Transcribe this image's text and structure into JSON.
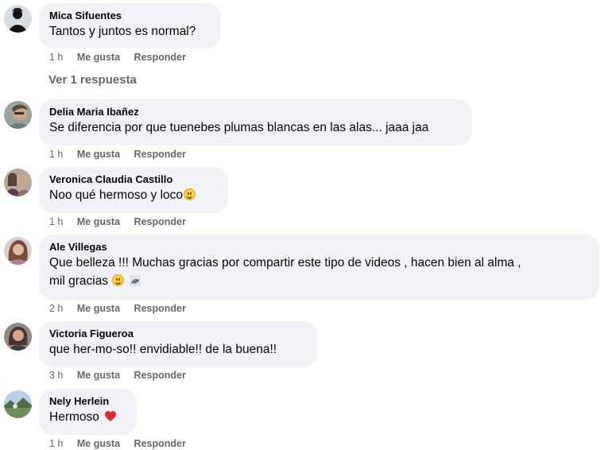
{
  "comments": [
    {
      "author": "Mica Sifuentes",
      "text": "Tantos y juntos es normal?",
      "time": "1 h",
      "like_label": "Me gusta",
      "reply_label": "Responder",
      "avatar_icon": "avatar-silhouette-icon"
    },
    {
      "author": "Delia Maria Ibañez",
      "text": "Se diferencia por que tuenebes plumas blancas en las alas... jaaa jaa",
      "time": "1 h",
      "like_label": "Me gusta",
      "reply_label": "Responder"
    },
    {
      "author": "Veronica Claudia Castillo",
      "text": "Noo qué hermoso y loco",
      "emoji": "smile-emoji",
      "time": "1 h",
      "like_label": "Me gusta",
      "reply_label": "Responder"
    },
    {
      "author": "Ale Villegas",
      "text_line1": "Que belleza !!! Muchas gracias por compartir este tipo de videos , hacen bien al alma ,",
      "text_line2": "mil gracias",
      "emojis": [
        "smile-emoji",
        "bird-emoji"
      ],
      "time": "2 h",
      "like_label": "Me gusta",
      "reply_label": "Responder"
    },
    {
      "author": "Victoria Figueroa",
      "text": "que her-mo-so!! envidiable!! de la buena!!",
      "time": "3 h",
      "like_label": "Me gusta",
      "reply_label": "Responder"
    },
    {
      "author": "Nely Herlein",
      "text": "Hermoso",
      "emoji": "heart-emoji",
      "time": "1 h",
      "like_label": "Me gusta",
      "reply_label": "Responder"
    }
  ],
  "view_replies_label": "Ver 1 respuesta",
  "colors": {
    "bubble": "#f0f2f5",
    "meta_text": "#65676b",
    "name_text": "#050505"
  }
}
